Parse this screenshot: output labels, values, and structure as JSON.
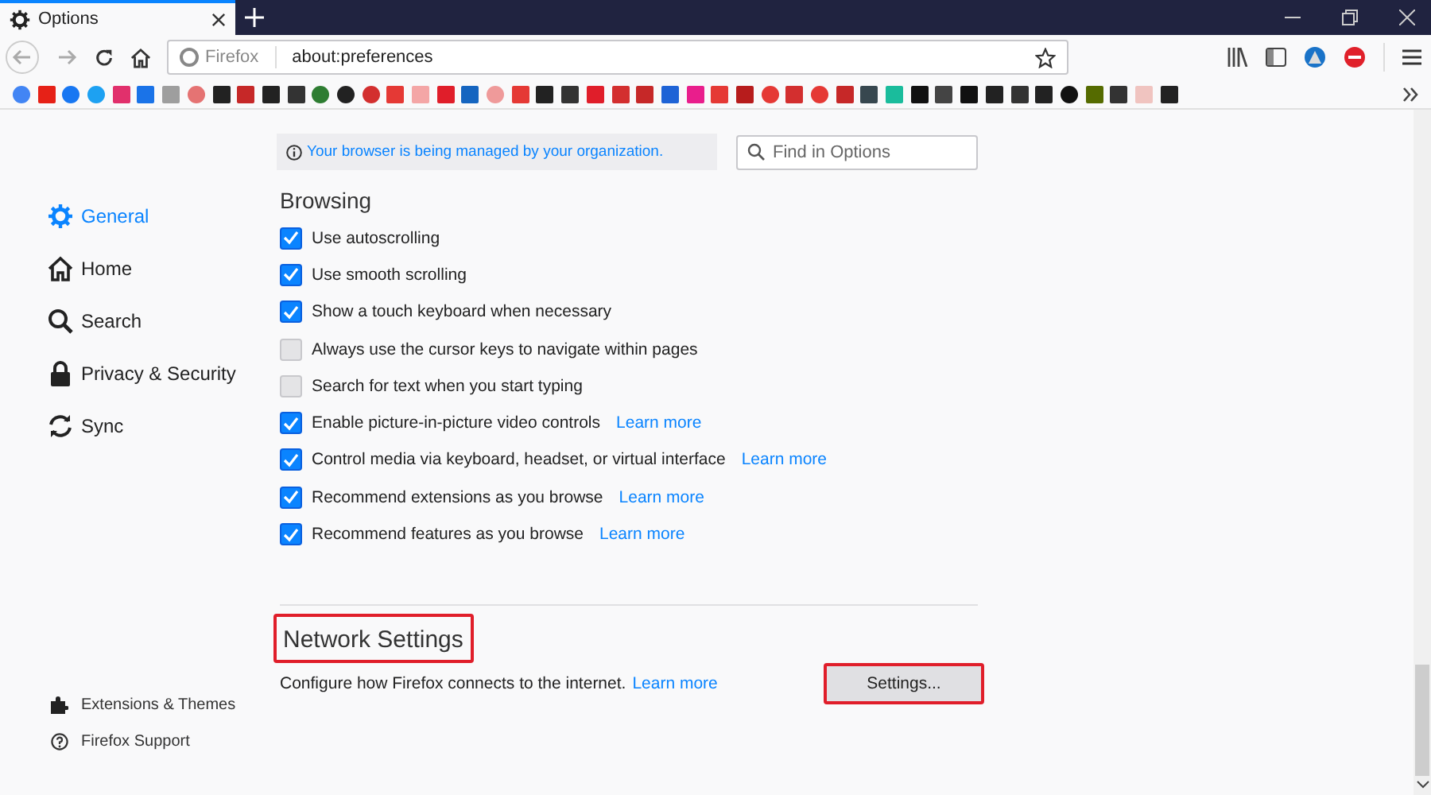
{
  "window": {
    "tab_title": "Options"
  },
  "address_bar": {
    "identity": "Firefox",
    "url": "about:preferences"
  },
  "bookmarks": [
    {
      "color": "#4285f4",
      "kind": "circle"
    },
    {
      "color": "#e62117",
      "kind": "square"
    },
    {
      "color": "#1877f2",
      "kind": "circle"
    },
    {
      "color": "#1da1f2",
      "kind": "circle"
    },
    {
      "color": "#e1306c",
      "kind": "square"
    },
    {
      "color": "#1a73e8",
      "kind": "square"
    },
    {
      "color": "#9e9e9e",
      "kind": "square"
    },
    {
      "color": "#e57373",
      "kind": "circle"
    },
    {
      "color": "#222222",
      "kind": "square"
    },
    {
      "color": "#c62828",
      "kind": "square"
    },
    {
      "color": "#222222",
      "kind": "square"
    },
    {
      "color": "#333333",
      "kind": "square"
    },
    {
      "color": "#2e7d32",
      "kind": "circle"
    },
    {
      "color": "#222222",
      "kind": "circle"
    },
    {
      "color": "#d32f2f",
      "kind": "circle"
    },
    {
      "color": "#e53935",
      "kind": "square"
    },
    {
      "color": "#f4a6a6",
      "kind": "square"
    },
    {
      "color": "#e01e2a",
      "kind": "square"
    },
    {
      "color": "#1565c0",
      "kind": "square"
    },
    {
      "color": "#ef9a9a",
      "kind": "circle"
    },
    {
      "color": "#e53935",
      "kind": "square"
    },
    {
      "color": "#222222",
      "kind": "square"
    },
    {
      "color": "#333333",
      "kind": "square"
    },
    {
      "color": "#e01e2a",
      "kind": "square"
    },
    {
      "color": "#d32f2f",
      "kind": "square"
    },
    {
      "color": "#c62828",
      "kind": "square"
    },
    {
      "color": "#1e63d6",
      "kind": "square"
    },
    {
      "color": "#e91e8c",
      "kind": "square"
    },
    {
      "color": "#e53935",
      "kind": "square"
    },
    {
      "color": "#b71c1c",
      "kind": "square"
    },
    {
      "color": "#e53935",
      "kind": "circle"
    },
    {
      "color": "#d32f2f",
      "kind": "square"
    },
    {
      "color": "#e53935",
      "kind": "circle"
    },
    {
      "color": "#c62828",
      "kind": "square"
    },
    {
      "color": "#37474f",
      "kind": "square"
    },
    {
      "color": "#1abc9c",
      "kind": "square"
    },
    {
      "color": "#111111",
      "kind": "square"
    },
    {
      "color": "#444444",
      "kind": "square"
    },
    {
      "color": "#111111",
      "kind": "square"
    },
    {
      "color": "#222222",
      "kind": "square"
    },
    {
      "color": "#333333",
      "kind": "square"
    },
    {
      "color": "#222222",
      "kind": "square"
    },
    {
      "color": "#111111",
      "kind": "circle"
    },
    {
      "color": "#556b00",
      "kind": "square"
    },
    {
      "color": "#333333",
      "kind": "square"
    },
    {
      "color": "#f0c4c0",
      "kind": "square"
    },
    {
      "color": "#222222",
      "kind": "square"
    }
  ],
  "sidebar": {
    "items": [
      {
        "label": "General",
        "kind": "gear",
        "selected": true
      },
      {
        "label": "Home",
        "kind": "home",
        "selected": false
      },
      {
        "label": "Search",
        "kind": "search",
        "selected": false
      },
      {
        "label": "Privacy & Security",
        "kind": "lock",
        "selected": false
      },
      {
        "label": "Sync",
        "kind": "sync",
        "selected": false
      }
    ],
    "footer": [
      {
        "label": "Extensions & Themes",
        "kind": "puzzle"
      },
      {
        "label": "Firefox Support",
        "kind": "help"
      }
    ]
  },
  "notice": "Your browser is being managed by your organization.",
  "search": {
    "placeholder": "Find in Options"
  },
  "browsing": {
    "heading": "Browsing",
    "options": [
      {
        "label": "Use autoscrolling",
        "checked": true
      },
      {
        "label": "Use smooth scrolling",
        "checked": true
      },
      {
        "label": "Show a touch keyboard when necessary",
        "checked": true
      },
      {
        "label": "Always use the cursor keys to navigate within pages",
        "checked": false
      },
      {
        "label": "Search for text when you start typing",
        "checked": false
      },
      {
        "label": "Enable picture-in-picture video controls",
        "checked": true,
        "link": "Learn more"
      },
      {
        "label": "Control media via keyboard, headset, or virtual interface",
        "checked": true,
        "link": "Learn more"
      },
      {
        "label": "Recommend extensions as you browse",
        "checked": true,
        "link": "Learn more"
      },
      {
        "label": "Recommend features as you browse",
        "checked": true,
        "link": "Learn more"
      }
    ]
  },
  "network": {
    "heading": "Network Settings",
    "heading_highlighted": true,
    "description": "Configure how Firefox connects to the internet.",
    "link": "Learn more",
    "button": "Settings...",
    "button_highlighted": true
  }
}
